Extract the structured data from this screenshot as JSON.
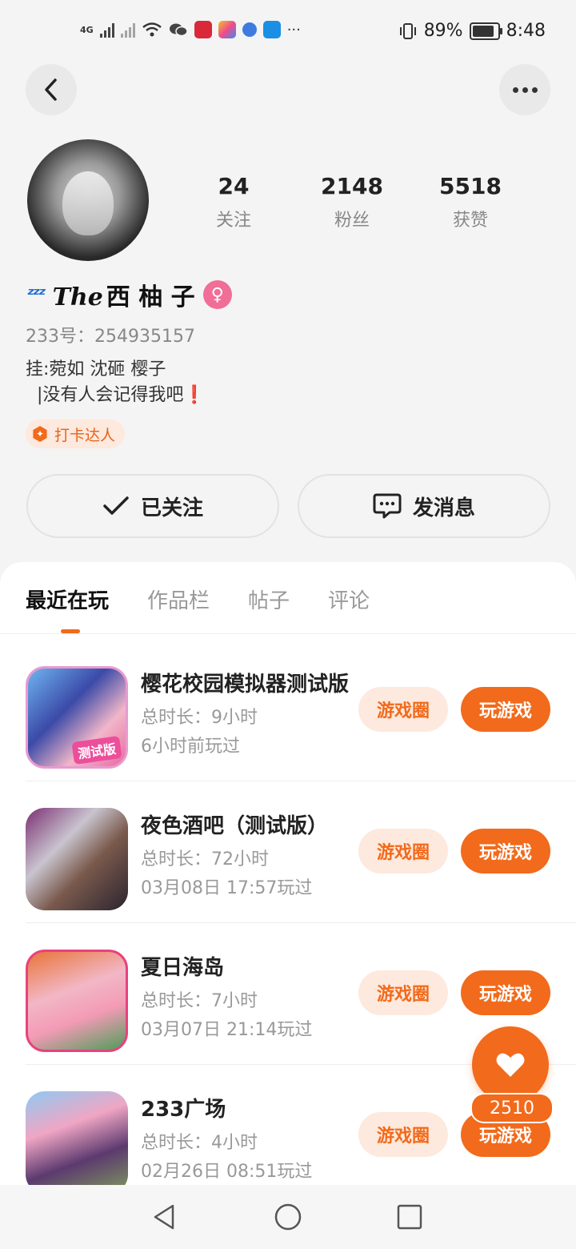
{
  "status_bar": {
    "network": "4G",
    "battery": "89%",
    "battery_level": 0.89,
    "time": "8:48",
    "more_indicator": "···"
  },
  "header": {
    "back_icon": "chevron-left-icon",
    "more_icon": "more-horizontal-icon"
  },
  "profile": {
    "stats": [
      {
        "value": "24",
        "label": "关注"
      },
      {
        "value": "2148",
        "label": "粉丝"
      },
      {
        "value": "5518",
        "label": "获赞"
      }
    ],
    "name_prefix": "The",
    "name": "西 柚 子",
    "gender_icon": "female-icon",
    "uid": "233号：254935157",
    "bio": "挂:菀如 沈砸 樱子\n  |没有人会记得我吧❗",
    "badge": "打卡达人"
  },
  "actions": {
    "follow": "已关注",
    "message": "发消息"
  },
  "tabs": [
    "最近在玩",
    "作品栏",
    "帖子",
    "评论"
  ],
  "games": [
    {
      "title": "樱花校园模拟器测试版",
      "duration": "总时长：9小时",
      "last_played": "6小时前玩过",
      "circle": "游戏圈",
      "play": "玩游戏"
    },
    {
      "title": "夜色酒吧（测试版）",
      "duration": "总时长：72小时",
      "last_played": "03月08日 17:57玩过",
      "circle": "游戏圈",
      "play": "玩游戏"
    },
    {
      "title": "夏日海岛",
      "duration": "总时长：7小时",
      "last_played": "03月07日 21:14玩过",
      "circle": "游戏圈",
      "play": "玩游戏"
    },
    {
      "title": "233广场",
      "duration": "总时长：4小时",
      "last_played": "02月26日 08:51玩过",
      "circle": "游戏圈",
      "play": "玩游戏"
    }
  ],
  "like_fab": {
    "count": "2510"
  },
  "colors": {
    "accent": "#f26a1b",
    "accent_light": "#fde9dd",
    "female": "#f06e97"
  }
}
